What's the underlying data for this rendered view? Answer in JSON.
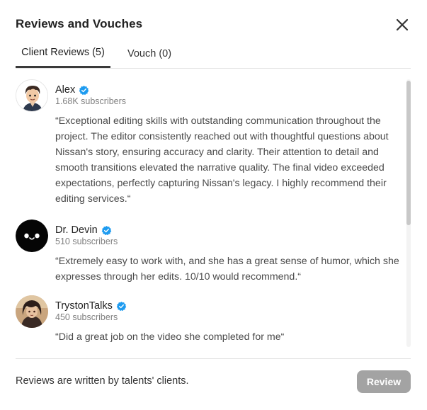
{
  "modal": {
    "title": "Reviews and Vouches"
  },
  "tabs": [
    {
      "label": "Client Reviews (5)",
      "active": true
    },
    {
      "label": "Vouch (0)",
      "active": false
    }
  ],
  "reviews": [
    {
      "name": "Alex",
      "verified": true,
      "subscribers": "1.68K subscribers",
      "quote": "“Exceptional editing skills with outstanding communication throughout the project. The editor consistently reached out with thoughtful questions about Nissan's story, ensuring accuracy and clarity. Their attention to detail and smooth transitions elevated the narrative quality. The final video exceeded expectations, perfectly capturing Nissan's legacy. I highly recommend their editing services.“",
      "avatar_icon": "cartoon-person-avatar"
    },
    {
      "name": "Dr. Devin",
      "verified": true,
      "subscribers": "510 subscribers",
      "quote": "“Extremely easy to work with, and she has a great sense of humor, which she expresses through her edits. 10/10 would recommend.“",
      "avatar_icon": "smiley-face-avatar"
    },
    {
      "name": "TrystonTalks",
      "verified": true,
      "subscribers": "450 subscribers",
      "quote": "“Did a great job on the video she completed for me“",
      "avatar_icon": "anime-character-avatar"
    }
  ],
  "footer": {
    "note": "Reviews are written by talents' clients.",
    "review_button_label": "Review"
  },
  "colors": {
    "verified_badge": "#1d9bf0",
    "button_disabled": "#a3a3a3",
    "text_primary": "#222222",
    "text_secondary": "#808080"
  },
  "icons": {
    "close": "close-icon",
    "verified": "verified-badge-icon"
  }
}
